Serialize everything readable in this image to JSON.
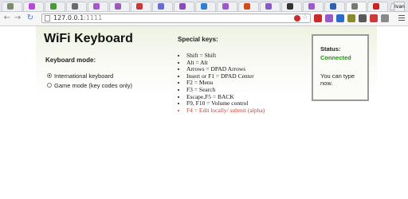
{
  "browser": {
    "tabs": [
      {
        "favicon_color": "#7b8b6b",
        "active": false
      },
      {
        "favicon_color": "#b24ad6",
        "active": false
      },
      {
        "favicon_color": "#4a9a3a",
        "active": false
      },
      {
        "favicon_color": "#6a6a6a",
        "active": false
      },
      {
        "favicon_color": "#a45ac8",
        "active": false
      },
      {
        "favicon_color": "#9a5ab8",
        "active": false
      },
      {
        "favicon_color": "#c83a3a",
        "active": false
      },
      {
        "favicon_color": "#6a6ad0",
        "active": false
      },
      {
        "favicon_color": "#8a4ab8",
        "active": false
      },
      {
        "favicon_color": "#2f7fd0",
        "active": false
      },
      {
        "favicon_color": "#9a5ac8",
        "active": false
      },
      {
        "favicon_color": "#d04a1a",
        "active": false
      },
      {
        "favicon_color": "#8a5ac8",
        "active": false
      },
      {
        "favicon_color": "#333333",
        "active": false
      },
      {
        "favicon_color": "#9a5ac8",
        "active": false
      },
      {
        "favicon_color": "#2f5fb0",
        "active": false
      },
      {
        "favicon_color": "#777777",
        "active": true
      },
      {
        "favicon_color": "#cc2222",
        "active": false
      }
    ],
    "profile_label": "Ivan",
    "url_host": "127.0.0.1",
    "url_port": ":1111",
    "nav_icons": [
      "back-arrow-icon",
      "forward-arrow-icon",
      "reload-icon"
    ],
    "extension_colors": [
      "#cc2a2a",
      "#9a5ac8",
      "#2a6ac8",
      "#8a8a2a",
      "#5a5a5a",
      "#cc3a3a",
      "#8a8a8a"
    ]
  },
  "app": {
    "title": "WiFi Keyboard",
    "mode_heading": "Keyboard mode:",
    "modes": [
      {
        "label": "International keyboard",
        "checked": true
      },
      {
        "label": "Game mode (key codes only)",
        "checked": false
      }
    ],
    "special_heading": "Special keys:",
    "special_keys": [
      {
        "text": "Shift = Shift",
        "highlight": false
      },
      {
        "text": "Alt = Alt",
        "highlight": false
      },
      {
        "text": "Arrows = DPAD Arrows",
        "highlight": false
      },
      {
        "text": "Insert or F1 = DPAD Center",
        "highlight": false
      },
      {
        "text": "F2 = Menu",
        "highlight": false
      },
      {
        "text": "F3 = Search",
        "highlight": false
      },
      {
        "text": "Escape,F5 = BACK",
        "highlight": false
      },
      {
        "text": "F9, F10 = Volume control",
        "highlight": false
      },
      {
        "text": "F4 = Edit locally/ submit (alpha)",
        "highlight": true
      }
    ],
    "status": {
      "label": "Status:",
      "value": "Connected",
      "note": "You can type now."
    }
  },
  "colors": {
    "connected": "#2a8a1a",
    "alpha_key": "#d23c2c"
  }
}
